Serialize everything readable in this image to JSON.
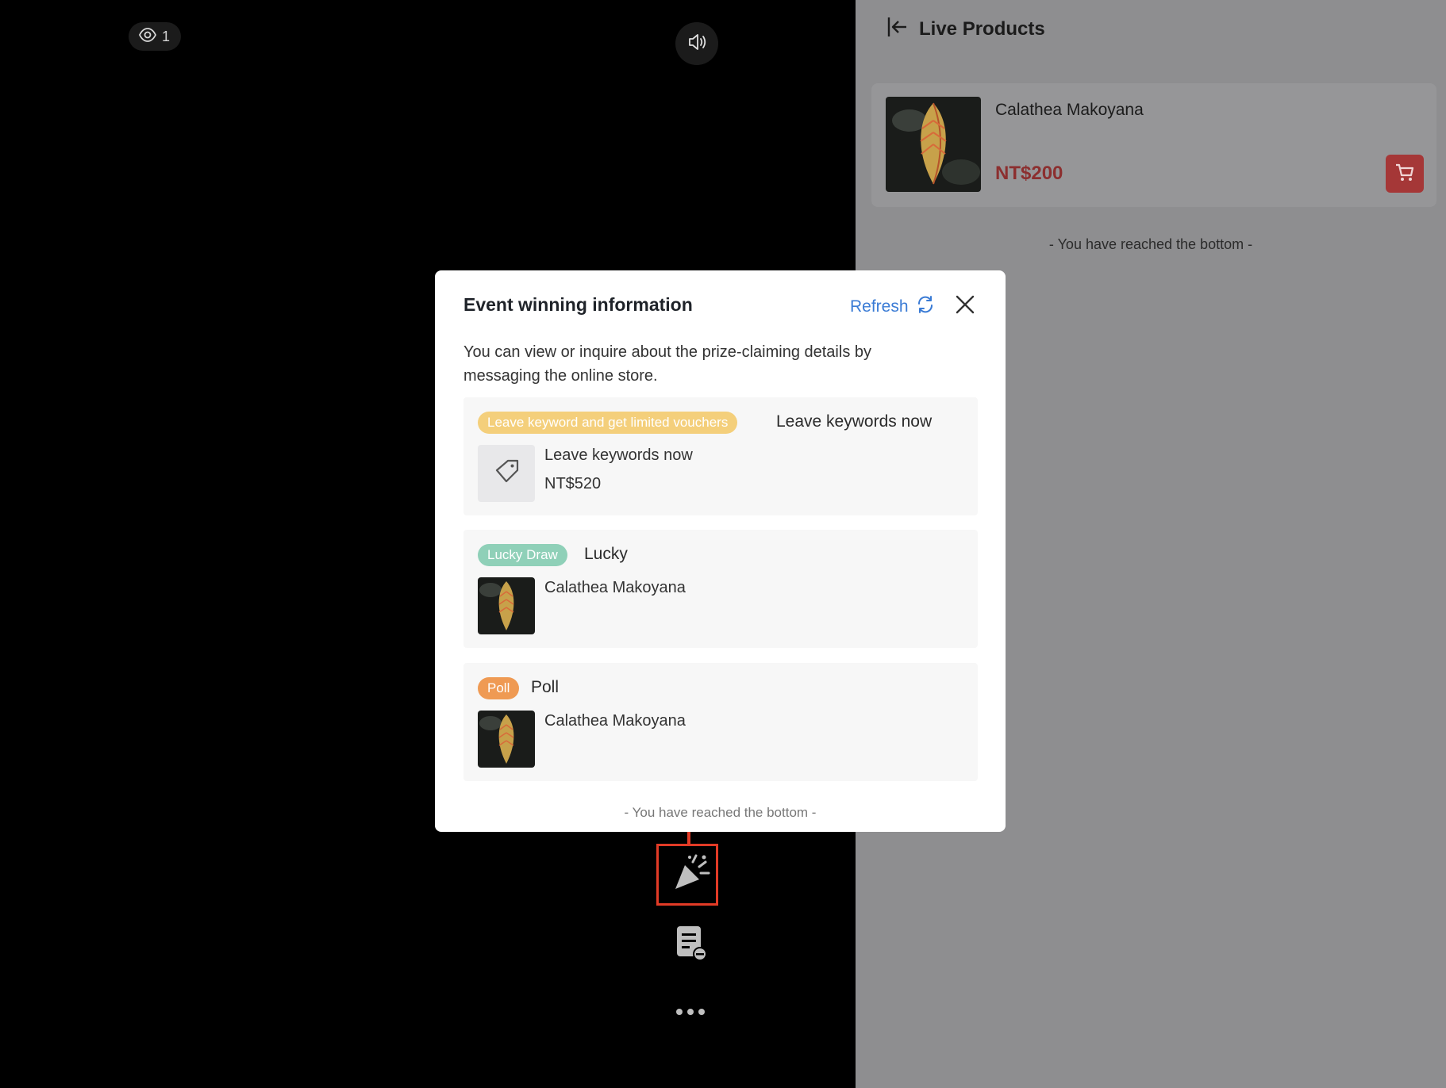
{
  "stream": {
    "viewer_count": "1",
    "icons": {
      "viewers": "eye-icon",
      "sound": "speaker-icon",
      "celebrate": "party-popper-icon",
      "document": "document-minus-icon",
      "more": "more-dots-icon"
    }
  },
  "side_panel": {
    "title": "Live Products",
    "product": {
      "name": "Calathea Makoyana",
      "price": "NT$200"
    },
    "bottom_text": "- You have reached the bottom -"
  },
  "modal": {
    "title": "Event winning information",
    "refresh_label": "Refresh",
    "description": "You can view or inquire about the prize-claiming details by messaging the online store.",
    "events": [
      {
        "tag": "Leave keyword and get limited vouchers",
        "name": "Leave keywords now",
        "item_title": "Leave keywords now",
        "item_price": "NT$520"
      },
      {
        "tag": "Lucky Draw",
        "name": "Lucky",
        "item_title": "Calathea Makoyana"
      },
      {
        "tag": "Poll",
        "name": "Poll",
        "item_title": "Calathea Makoyana"
      }
    ],
    "bottom_text": "- You have reached the bottom -"
  },
  "colors": {
    "accent_blue": "#3a7bd5",
    "price_red": "#8c2f2f",
    "highlight": "#e23b26",
    "tag_keyword": "#f4cf7b",
    "tag_lucky": "#8fd0b8",
    "tag_poll": "#ef9a53"
  }
}
